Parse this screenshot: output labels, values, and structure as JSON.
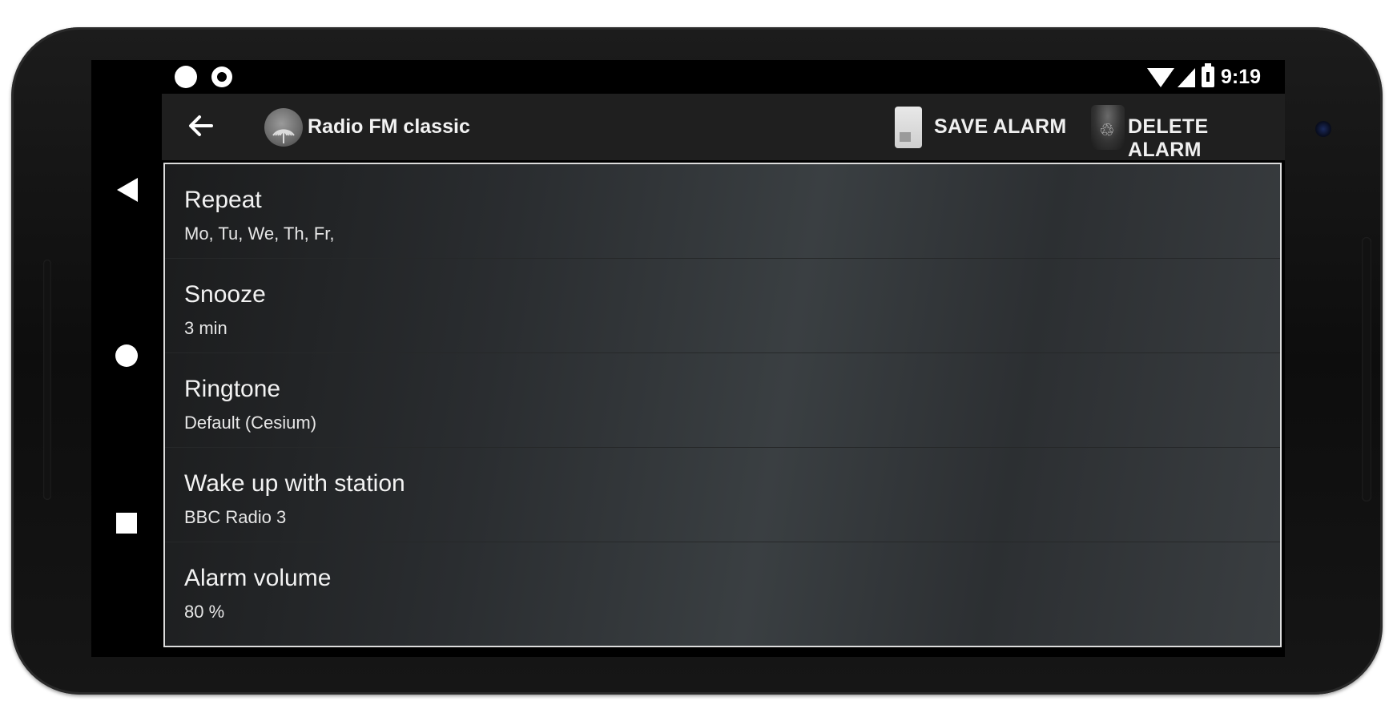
{
  "status_bar": {
    "time": "9:19",
    "icons": [
      "circle-icon",
      "circle-outline-icon",
      "wifi-icon",
      "signal-icon",
      "battery-icon"
    ]
  },
  "nav_bar": {
    "icons": [
      "back-triangle-icon",
      "home-circle-icon",
      "recents-square-icon"
    ]
  },
  "app_bar": {
    "title": "Radio FM classic",
    "save_label": "SAVE ALARM",
    "delete_label": "DELETE ALARM",
    "icons": [
      "back-arrow-icon",
      "app-logo-icon",
      "sd-card-icon",
      "trash-icon"
    ]
  },
  "settings": [
    {
      "title": "Repeat",
      "value": "Mo, Tu, We, Th, Fr,"
    },
    {
      "title": "Snooze",
      "value": " 3 min"
    },
    {
      "title": "Ringtone",
      "value": "Default (Cesium)"
    },
    {
      "title": "Wake up with station",
      "value": "BBC Radio 3"
    },
    {
      "title": "Alarm volume",
      "value": "80 %"
    }
  ]
}
